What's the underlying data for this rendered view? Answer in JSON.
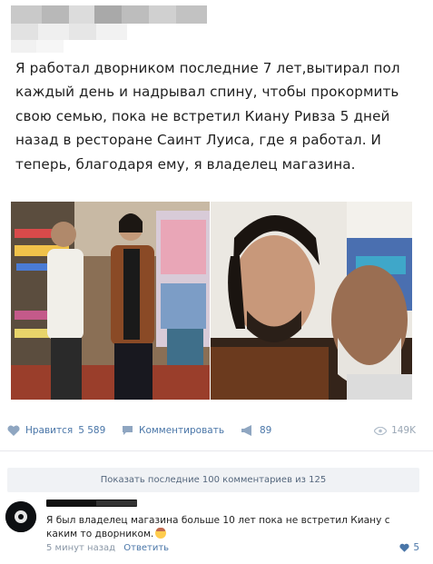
{
  "post": {
    "author_hidden": true,
    "text": "Я работал дворником последние 7 лет,вытирал пол каждый день и надрывал спину, чтобы прокормить свою семью, пока не встретил Киану Ривза 5 дней назад в ресторане Саинт Луиса, где я работал. И теперь, благодаря ему, я владелец магазина.",
    "photos": [
      {
        "icon": "photo-store-two-men"
      },
      {
        "icon": "photo-selfie-two-men"
      }
    ]
  },
  "actions": {
    "like_label": "Нравится",
    "like_count": "5 589",
    "comment_label": "Комментировать",
    "share_count": "89",
    "views_count": "149K"
  },
  "comments": {
    "show_more_label": "Показать последние 100 комментариев из 125",
    "items": [
      {
        "author_hidden": true,
        "text": "Я был владелец магазина больше 10 лет пока не встретил Киану с каким то дворником.",
        "time": "5 минут назад",
        "reply_label": "Ответить",
        "likes": "5"
      }
    ]
  },
  "colors": {
    "link": "#4a76a8",
    "muted": "#9aa7b5",
    "show_more_bg": "#f0f2f5",
    "divider": "#e7e8ec"
  }
}
